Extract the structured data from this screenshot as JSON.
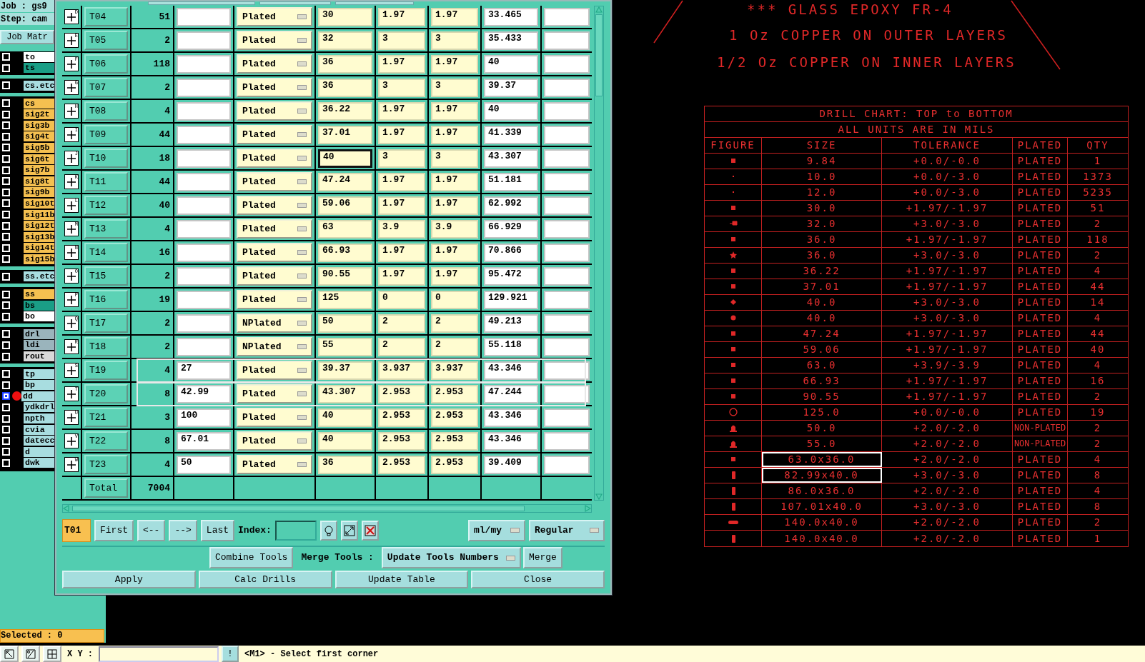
{
  "sidebar": {
    "job": "Job : gs9",
    "step": "Step: cam",
    "matrix_button": "Job Matr",
    "layer_groups": [
      [
        {
          "name": "to",
          "color": "#ffffff",
          "active": false
        },
        {
          "name": "ts",
          "color": "#1a9e86",
          "active": false
        }
      ],
      [
        {
          "name": "cs.etc",
          "color": "#a8dde0",
          "active": false
        }
      ],
      [
        {
          "name": "cs",
          "color": "#f5c050",
          "active": false
        },
        {
          "name": "sig2t",
          "color": "#f5c050",
          "active": false
        },
        {
          "name": "sig3b",
          "color": "#f5c050",
          "active": false
        },
        {
          "name": "sig4t",
          "color": "#f5c050",
          "active": false
        },
        {
          "name": "sig5b",
          "color": "#f5c050",
          "active": false
        },
        {
          "name": "sig6t",
          "color": "#f5c050",
          "active": false
        },
        {
          "name": "sig7b",
          "color": "#f5c050",
          "active": false
        },
        {
          "name": "sig8t",
          "color": "#f5c050",
          "active": false
        },
        {
          "name": "sig9b",
          "color": "#f5c050",
          "active": false
        },
        {
          "name": "sig10t",
          "color": "#f5c050",
          "active": false
        },
        {
          "name": "sig11b",
          "color": "#f5c050",
          "active": false
        },
        {
          "name": "sig12t",
          "color": "#f5c050",
          "active": false
        },
        {
          "name": "sig13b",
          "color": "#f5c050",
          "active": false
        },
        {
          "name": "sig14t",
          "color": "#f5c050",
          "active": false
        },
        {
          "name": "sig15b",
          "color": "#f5c050",
          "active": false
        }
      ],
      [
        {
          "name": "ss.etc",
          "color": "#a8dde0",
          "active": false
        }
      ],
      [
        {
          "name": "ss",
          "color": "#f5c050",
          "active": false
        },
        {
          "name": "bs",
          "color": "#1a9e86",
          "active": false
        },
        {
          "name": "bo",
          "color": "#ffffff",
          "active": false
        }
      ],
      [
        {
          "name": "drl",
          "color": "#9ab4bc",
          "active": false
        },
        {
          "name": "ldi",
          "color": "#9ab4bc",
          "active": false
        },
        {
          "name": "rout",
          "color": "#d9d9d9",
          "active": false
        }
      ],
      [
        {
          "name": "tp",
          "color": "#a8dde0",
          "active": false
        },
        {
          "name": "bp",
          "color": "#a8dde0",
          "active": false
        },
        {
          "name": "dd",
          "color": "#a8dde0",
          "active": true
        },
        {
          "name": "ydkdrl",
          "color": "#a8dde0",
          "active": false
        },
        {
          "name": "npth",
          "color": "#a8dde0",
          "active": false
        },
        {
          "name": "cvia",
          "color": "#a8dde0",
          "active": false
        },
        {
          "name": "datecc",
          "color": "#a8dde0",
          "active": false
        },
        {
          "name": "d",
          "color": "#a8dde0",
          "active": false
        },
        {
          "name": "dwk",
          "color": "#a8dde0",
          "active": false
        }
      ]
    ],
    "selected_label": "Selected : 0"
  },
  "dialog": {
    "rows": [
      {
        "letter": "D",
        "tool": "T04",
        "count": "51",
        "type": "Plated",
        "finish": "30",
        "tol_plus": "1.97",
        "tol_minus": "1.97",
        "drill": "33.465",
        "selected": false,
        "focused": false
      },
      {
        "letter": "E",
        "tool": "T05",
        "count": "2",
        "type": "Plated",
        "finish": "32",
        "tol_plus": "3",
        "tol_minus": "3",
        "drill": "35.433",
        "selected": false,
        "focused": false
      },
      {
        "letter": "F",
        "tool": "T06",
        "count": "118",
        "type": "Plated",
        "finish": "36",
        "tol_plus": "1.97",
        "tol_minus": "1.97",
        "drill": "40",
        "selected": false,
        "focused": false
      },
      {
        "letter": "G",
        "tool": "T07",
        "count": "2",
        "type": "Plated",
        "finish": "36",
        "tol_plus": "3",
        "tol_minus": "3",
        "drill": "39.37",
        "selected": false,
        "focused": false
      },
      {
        "letter": "H",
        "tool": "T08",
        "count": "4",
        "type": "Plated",
        "finish": "36.22",
        "tol_plus": "1.97",
        "tol_minus": "1.97",
        "drill": "40",
        "selected": false,
        "focused": false
      },
      {
        "letter": "I",
        "tool": "T09",
        "count": "44",
        "type": "Plated",
        "finish": "37.01",
        "tol_plus": "1.97",
        "tol_minus": "1.97",
        "drill": "41.339",
        "selected": false,
        "focused": false
      },
      {
        "letter": "J",
        "tool": "T10",
        "count": "18",
        "type": "Plated",
        "finish": "40",
        "tol_plus": "3",
        "tol_minus": "3",
        "drill": "43.307",
        "selected": false,
        "focused": true
      },
      {
        "letter": "K",
        "tool": "T11",
        "count": "44",
        "type": "Plated",
        "finish": "47.24",
        "tol_plus": "1.97",
        "tol_minus": "1.97",
        "drill": "51.181",
        "selected": false,
        "focused": false
      },
      {
        "letter": "L",
        "tool": "T12",
        "count": "40",
        "type": "Plated",
        "finish": "59.06",
        "tol_plus": "1.97",
        "tol_minus": "1.97",
        "drill": "62.992",
        "selected": false,
        "focused": false
      },
      {
        "letter": "M",
        "tool": "T13",
        "count": "4",
        "type": "Plated",
        "finish": "63",
        "tol_plus": "3.9",
        "tol_minus": "3.9",
        "drill": "66.929",
        "selected": false,
        "focused": false
      },
      {
        "letter": "N",
        "tool": "T14",
        "count": "16",
        "type": "Plated",
        "finish": "66.93",
        "tol_plus": "1.97",
        "tol_minus": "1.97",
        "drill": "70.866",
        "selected": false,
        "focused": false
      },
      {
        "letter": "O",
        "tool": "T15",
        "count": "2",
        "type": "Plated",
        "finish": "90.55",
        "tol_plus": "1.97",
        "tol_minus": "1.97",
        "drill": "95.472",
        "selected": false,
        "focused": false
      },
      {
        "letter": "P",
        "tool": "T16",
        "count": "19",
        "type": "Plated",
        "finish": "125",
        "tol_plus": "0",
        "tol_minus": "0",
        "drill": "129.921",
        "selected": false,
        "focused": false
      },
      {
        "letter": "Q",
        "tool": "T17",
        "count": "2",
        "type": "NPlated",
        "finish": "50",
        "tol_plus": "2",
        "tol_minus": "2",
        "drill": "49.213",
        "selected": false,
        "focused": false
      },
      {
        "letter": "R",
        "tool": "T18",
        "count": "2",
        "type": "NPlated",
        "finish": "55",
        "tol_plus": "2",
        "tol_minus": "2",
        "drill": "55.118",
        "selected": false,
        "focused": false
      },
      {
        "letter": "S",
        "tool": "T19",
        "count": "4",
        "size": "27",
        "type": "Plated",
        "finish": "39.37",
        "tol_plus": "3.937",
        "tol_minus": "3.937",
        "drill": "43.346",
        "selected": true,
        "focused": false
      },
      {
        "letter": "T",
        "tool": "T20",
        "count": "8",
        "size": "42.99",
        "type": "Plated",
        "finish": "43.307",
        "tol_plus": "2.953",
        "tol_minus": "2.953",
        "drill": "47.244",
        "selected": true,
        "focused": false
      },
      {
        "letter": "U",
        "tool": "T21",
        "count": "3",
        "size": "100",
        "type": "Plated",
        "finish": "40",
        "tol_plus": "2.953",
        "tol_minus": "2.953",
        "drill": "43.346",
        "selected": false,
        "focused": false
      },
      {
        "letter": "V",
        "tool": "T22",
        "count": "8",
        "size": "67.01",
        "type": "Plated",
        "finish": "40",
        "tol_plus": "2.953",
        "tol_minus": "2.953",
        "drill": "43.346",
        "selected": false,
        "focused": false
      },
      {
        "letter": "W",
        "tool": "T23",
        "count": "4",
        "size": "50",
        "type": "Plated",
        "finish": "36",
        "tol_plus": "2.953",
        "tol_minus": "2.953",
        "drill": "39.409",
        "selected": false,
        "focused": false
      }
    ],
    "total": {
      "label": "Total",
      "count": "7004"
    },
    "nav": {
      "current": "T01",
      "buttons": [
        "First",
        "<--",
        "-->",
        "Last"
      ],
      "index_label": "Index:",
      "units": "ml/my",
      "mode": "Regular"
    },
    "merge": {
      "combine": "Combine Tools",
      "label": "Merge Tools :",
      "option": "Update Tools Numbers",
      "button": "Merge"
    },
    "actions": [
      "Apply",
      "Calc Drills",
      "Update Table",
      "Close"
    ]
  },
  "canvas": {
    "notes": [
      "*** GLASS EPOXY FR-4",
      "1 Oz COPPER ON OUTER LAYERS",
      "1/2 Oz COPPER ON INNER LAYERS"
    ],
    "drill_chart": {
      "title": "DRILL CHART: TOP to BOTTOM",
      "subtitle": "ALL UNITS ARE IN MILS",
      "columns": [
        "FIGURE",
        "SIZE",
        "TOLERANCE",
        "PLATED",
        "QTY"
      ],
      "rows": [
        {
          "kind": "square",
          "size": "9.84",
          "tolerance": "+0.0/-0.0",
          "plated": "PLATED",
          "qty": "1",
          "selected": false
        },
        {
          "kind": "dot",
          "size": "10.0",
          "tolerance": "+0.0/-3.0",
          "plated": "PLATED",
          "qty": "1373",
          "selected": false
        },
        {
          "kind": "dot",
          "size": "12.0",
          "tolerance": "+0.0/-3.0",
          "plated": "PLATED",
          "qty": "5235",
          "selected": false
        },
        {
          "kind": "square",
          "size": "30.0",
          "tolerance": "+1.97/-1.97",
          "plated": "PLATED",
          "qty": "51",
          "selected": false
        },
        {
          "kind": "tee",
          "size": "32.0",
          "tolerance": "+3.0/-3.0",
          "plated": "PLATED",
          "qty": "2",
          "selected": false
        },
        {
          "kind": "square",
          "size": "36.0",
          "tolerance": "+1.97/-1.97",
          "plated": "PLATED",
          "qty": "118",
          "selected": false
        },
        {
          "kind": "star",
          "size": "36.0",
          "tolerance": "+3.0/-3.0",
          "plated": "PLATED",
          "qty": "2",
          "selected": false
        },
        {
          "kind": "square",
          "size": "36.22",
          "tolerance": "+1.97/-1.97",
          "plated": "PLATED",
          "qty": "4",
          "selected": false
        },
        {
          "kind": "square",
          "size": "37.01",
          "tolerance": "+1.97/-1.97",
          "plated": "PLATED",
          "qty": "44",
          "selected": false
        },
        {
          "kind": "diamond",
          "size": "40.0",
          "tolerance": "+3.0/-3.0",
          "plated": "PLATED",
          "qty": "14",
          "selected": false
        },
        {
          "kind": "round",
          "size": "40.0",
          "tolerance": "+3.0/-3.0",
          "plated": "PLATED",
          "qty": "4",
          "selected": false
        },
        {
          "kind": "square",
          "size": "47.24",
          "tolerance": "+1.97/-1.97",
          "plated": "PLATED",
          "qty": "44",
          "selected": false
        },
        {
          "kind": "square",
          "size": "59.06",
          "tolerance": "+1.97/-1.97",
          "plated": "PLATED",
          "qty": "40",
          "selected": false
        },
        {
          "kind": "square",
          "size": "63.0",
          "tolerance": "+3.9/-3.9",
          "plated": "PLATED",
          "qty": "4",
          "selected": false
        },
        {
          "kind": "square",
          "size": "66.93",
          "tolerance": "+1.97/-1.97",
          "plated": "PLATED",
          "qty": "16",
          "selected": false
        },
        {
          "kind": "square",
          "size": "90.55",
          "tolerance": "+1.97/-1.97",
          "plated": "PLATED",
          "qty": "2",
          "selected": false
        },
        {
          "kind": "circle",
          "size": "125.0",
          "tolerance": "+0.0/-0.0",
          "plated": "PLATED",
          "qty": "19",
          "selected": false
        },
        {
          "kind": "bell",
          "size": "50.0",
          "tolerance": "+2.0/-2.0",
          "plated": "NON-PLATED",
          "qty": "2",
          "selected": false
        },
        {
          "kind": "bell",
          "size": "55.0",
          "tolerance": "+2.0/-2.0",
          "plated": "NON-PLATED",
          "qty": "2",
          "selected": false
        },
        {
          "kind": "square",
          "size": "63.0x36.0",
          "tolerance": "+2.0/-2.0",
          "plated": "PLATED",
          "qty": "4",
          "selected": true
        },
        {
          "kind": "slot",
          "size": "82.99x40.0",
          "tolerance": "+3.0/-3.0",
          "plated": "PLATED",
          "qty": "8",
          "selected": true
        },
        {
          "kind": "slot",
          "size": "86.0x36.0",
          "tolerance": "+2.0/-2.0",
          "plated": "PLATED",
          "qty": "4",
          "selected": false
        },
        {
          "kind": "slot",
          "size": "107.01x40.0",
          "tolerance": "+3.0/-3.0",
          "plated": "PLATED",
          "qty": "8",
          "selected": false
        },
        {
          "kind": "bar",
          "size": "140.0x40.0",
          "tolerance": "+2.0/-2.0",
          "plated": "PLATED",
          "qty": "2",
          "selected": false
        },
        {
          "kind": "slot",
          "size": "140.0x40.0",
          "tolerance": "+2.0/-2.0",
          "plated": "PLATED",
          "qty": "1",
          "selected": false
        }
      ]
    }
  },
  "status_bar": {
    "coords_label": "X Y :",
    "alert_button": "!",
    "message": "<M1> - Select first corner"
  }
}
